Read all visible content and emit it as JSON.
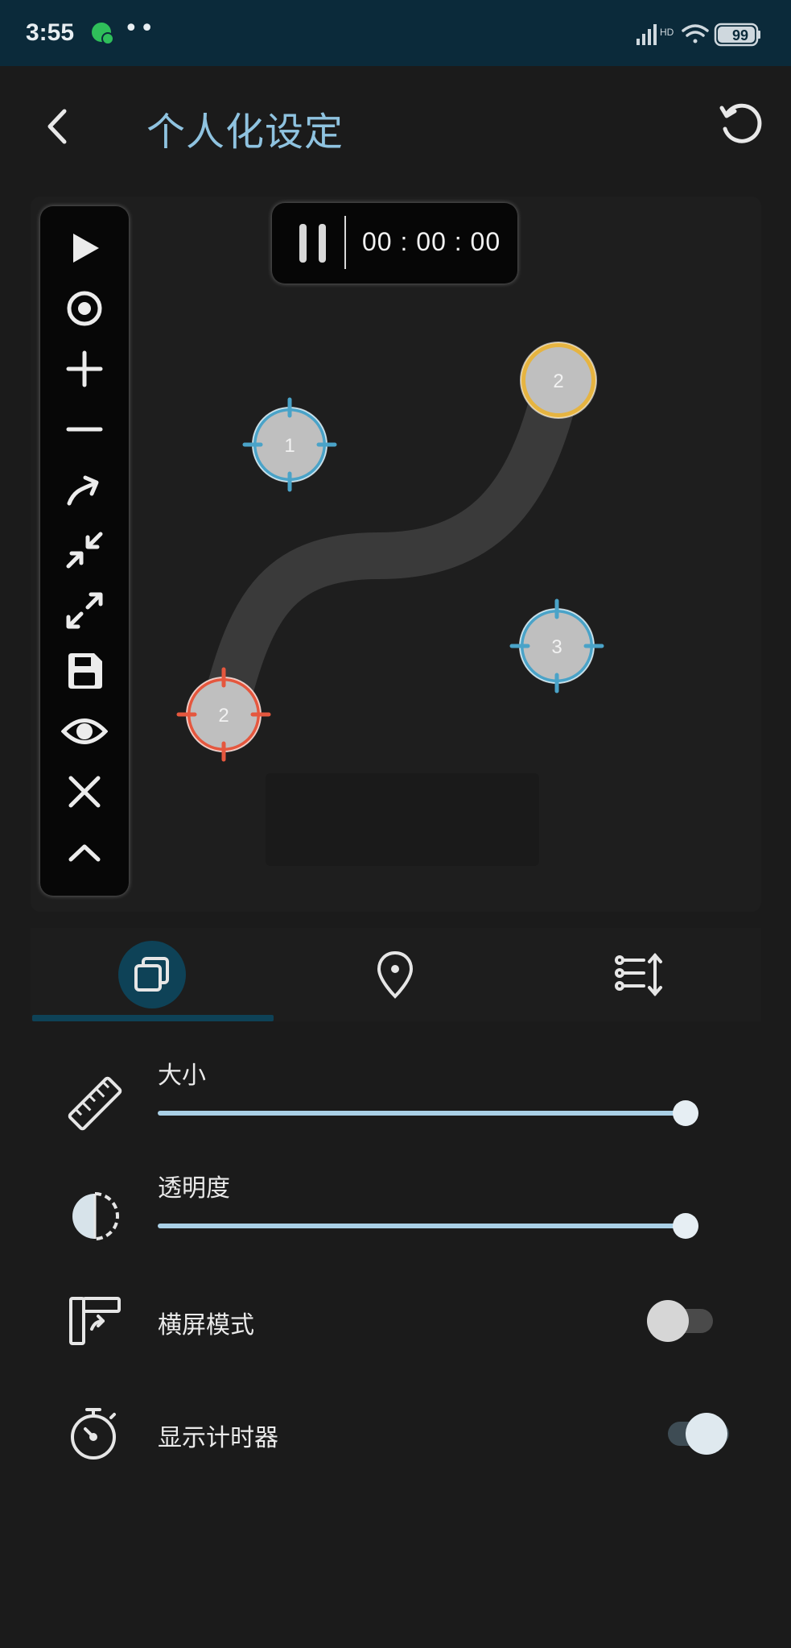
{
  "status_bar": {
    "time": "3:55",
    "dots": "••",
    "battery": "99",
    "icons": [
      "wechat-icon",
      "signal-icon",
      "wifi-icon",
      "battery-icon"
    ]
  },
  "header": {
    "title": "个人化设定",
    "back_icon": "back-arrow-icon",
    "reset_icon": "reset-icon"
  },
  "timer": {
    "time": "00 : 00 : 00"
  },
  "toolbar": {
    "tools": [
      "play-icon",
      "target-icon",
      "plus-icon",
      "minus-icon",
      "swipe-icon",
      "collapse-icon",
      "expand-icon",
      "save-icon",
      "eye-icon",
      "close-icon",
      "chevron-up-icon"
    ]
  },
  "markers": [
    {
      "label": "1",
      "color": "#4aa3c8",
      "type": "tap"
    },
    {
      "label": "2",
      "color": "#e6b441",
      "type": "swipe-end"
    },
    {
      "label": "2",
      "color": "#e5573e",
      "type": "swipe-start"
    },
    {
      "label": "3",
      "color": "#4aa3c8",
      "type": "tap"
    }
  ],
  "tabs": {
    "items": [
      "layers-icon",
      "location-pin-icon",
      "sort-list-icon"
    ],
    "active_index": 0
  },
  "settings": {
    "size": {
      "label": "大小",
      "value": 1.0
    },
    "opacity": {
      "label": "透明度",
      "value": 1.0
    },
    "landscape": {
      "label": "横屏模式",
      "enabled": false
    },
    "show_timer": {
      "label": "显示计时器",
      "enabled": true
    }
  },
  "colors": {
    "accent": "#8fc3e0",
    "tab_active": "#0e4257",
    "status_bar": "#0b2a3a",
    "background": "#1b1b1b"
  }
}
